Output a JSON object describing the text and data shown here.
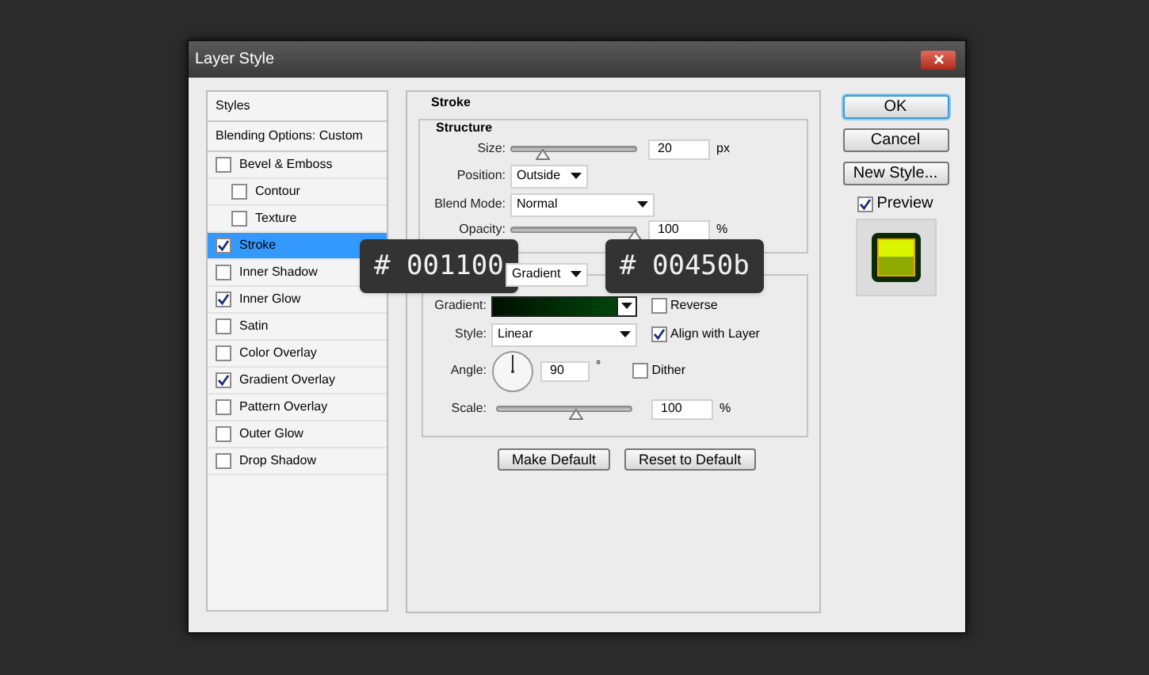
{
  "window": {
    "title": "Layer Style"
  },
  "styles_panel": {
    "header": "Styles",
    "blending": "Blending Options: Custom",
    "items": [
      {
        "label": "Bevel & Emboss",
        "checked": false,
        "selected": false,
        "children": [
          {
            "label": "Contour",
            "checked": false,
            "selected": false
          },
          {
            "label": "Texture",
            "checked": false,
            "selected": false
          }
        ]
      },
      {
        "label": "Stroke",
        "checked": true,
        "selected": true
      },
      {
        "label": "Inner Shadow",
        "checked": false,
        "selected": false
      },
      {
        "label": "Inner Glow",
        "checked": true,
        "selected": false
      },
      {
        "label": "Satin",
        "checked": false,
        "selected": false
      },
      {
        "label": "Color Overlay",
        "checked": false,
        "selected": false
      },
      {
        "label": "Gradient Overlay",
        "checked": true,
        "selected": false
      },
      {
        "label": "Pattern Overlay",
        "checked": false,
        "selected": false
      },
      {
        "label": "Outer Glow",
        "checked": false,
        "selected": false
      },
      {
        "label": "Drop Shadow",
        "checked": false,
        "selected": false
      }
    ]
  },
  "stroke": {
    "title": "Stroke",
    "structure": {
      "title": "Structure",
      "size": {
        "label": "Size:",
        "level": 0.25,
        "value": "20",
        "unit": "px"
      },
      "position": {
        "label": "Position:",
        "value": "Outside"
      },
      "blend_mode": {
        "label": "Blend Mode:",
        "value": "Normal"
      },
      "opacity": {
        "label": "Opacity:",
        "level": 1,
        "value": "100",
        "unit": "%"
      }
    },
    "fill": {
      "fill_type": "Gradient",
      "gradient": {
        "label": "Gradient:",
        "stops": [
          {
            "color": "#001100"
          },
          {
            "color": "#00450b"
          }
        ]
      },
      "reverse": {
        "label": "Reverse",
        "checked": false
      },
      "style": {
        "label": "Style:",
        "value": "Linear"
      },
      "align_with_layer": {
        "label": "Align with Layer",
        "checked": true
      },
      "angle": {
        "label": "Angle:",
        "value": "90",
        "unit": "°"
      },
      "dither": {
        "label": "Dither",
        "checked": false
      },
      "scale": {
        "label": "Scale:",
        "level": 0.6,
        "value": "100",
        "unit": "%"
      }
    },
    "buttons": [
      "Make Default",
      "Reset to Default"
    ]
  },
  "actions": [
    {
      "label": "OK",
      "default": true
    },
    {
      "label": "Cancel",
      "default": false
    },
    {
      "label": "New Style...",
      "default": false
    }
  ],
  "preview": {
    "label": "Preview",
    "checked": true
  },
  "color_badges": [
    {
      "text": "# 001100"
    },
    {
      "text": "# 00450b"
    }
  ]
}
